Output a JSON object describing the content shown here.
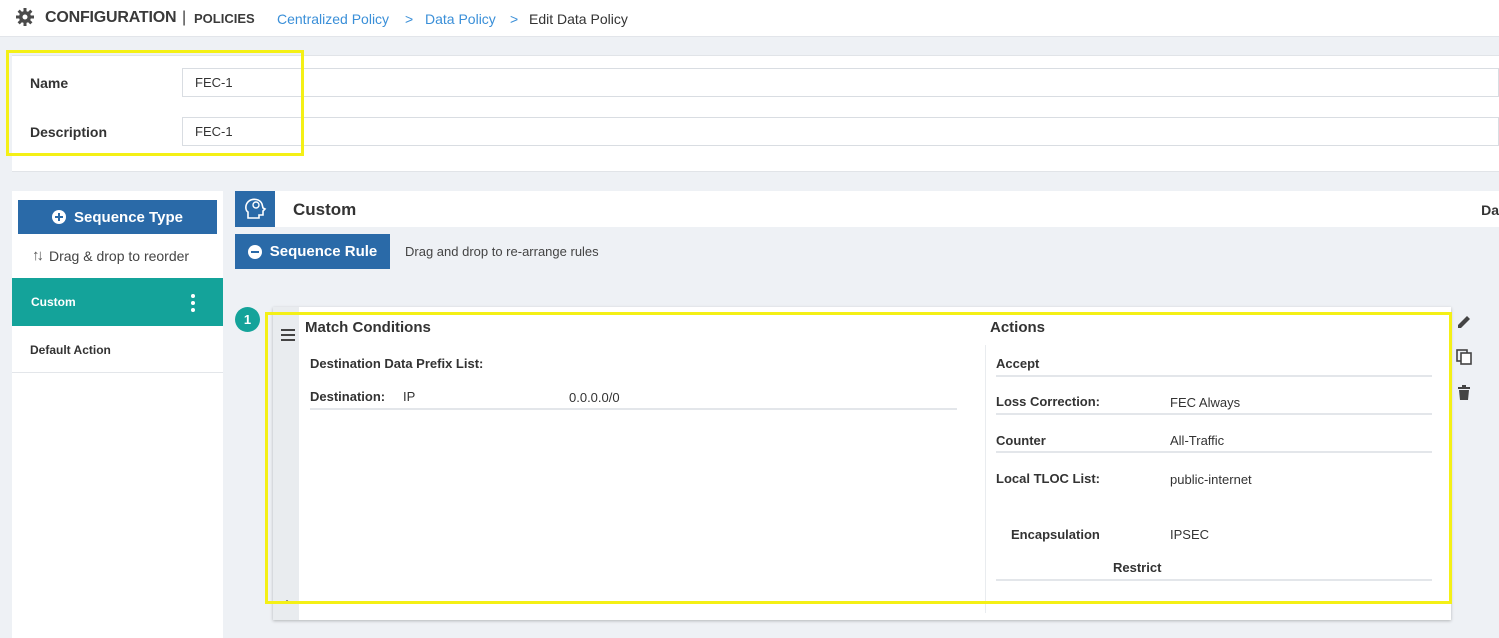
{
  "header": {
    "title": "CONFIGURATION",
    "separator": "|",
    "subtitle": "POLICIES",
    "breadcrumbs": [
      "Centralized Policy",
      "Data Policy",
      "Edit Data Policy"
    ],
    "breadcrumb_separator": ">"
  },
  "form": {
    "name_label": "Name",
    "name_value": "FEC-1",
    "description_label": "Description",
    "description_value": "FEC-1"
  },
  "sidebar": {
    "sequence_type_label": "Sequence Type",
    "reorder_label": "Drag & drop to reorder",
    "items": [
      {
        "label": "Custom",
        "active": true
      },
      {
        "label": "Default Action",
        "active": false
      }
    ]
  },
  "main": {
    "section_title": "Custom",
    "section_right": "Da",
    "sequence_rule_label": "Sequence Rule",
    "drag_hint": "Drag and drop to re-arrange rules",
    "rule_number": "1",
    "match": {
      "heading": "Match Conditions",
      "rows": [
        {
          "label": "Destination Data Prefix List:",
          "type": "",
          "value": ""
        },
        {
          "label": "Destination:",
          "type": "IP",
          "value": "0.0.0.0/0"
        }
      ]
    },
    "actions": {
      "heading": "Actions",
      "accept": "Accept",
      "rows": [
        {
          "label": "Loss Correction:",
          "value": "FEC Always"
        },
        {
          "label": "Counter",
          "value": "All-Traffic"
        },
        {
          "label": "Local TLOC List:",
          "value": "public-internet"
        }
      ],
      "encapsulation_label": "Encapsulation",
      "encapsulation_value": "IPSEC",
      "restrict_label": "Restrict"
    }
  },
  "colors": {
    "accent_blue": "#2a6aa8",
    "teal": "#14a39a",
    "highlight": "#f4f016",
    "link": "#3a8fd8"
  },
  "icons": [
    "gear-icon",
    "plus-circle-icon",
    "reorder-icon",
    "kebab-icon",
    "policy-icon",
    "minus-circle-icon",
    "menu-icon",
    "collapse-icon",
    "edit-icon",
    "copy-icon",
    "trash-icon"
  ]
}
